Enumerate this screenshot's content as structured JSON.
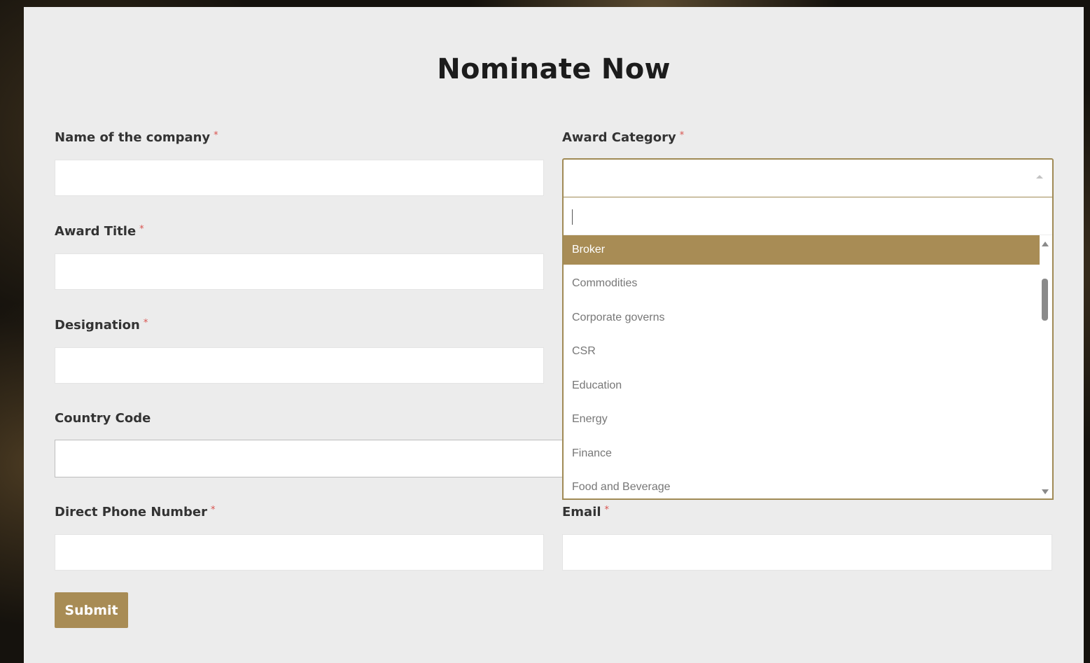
{
  "form": {
    "title": "Nominate Now",
    "required_mark": "*",
    "fields": {
      "company": {
        "label": "Name of the company",
        "value": ""
      },
      "award_category": {
        "label": "Award Category",
        "value": ""
      },
      "award_title": {
        "label": "Award Title",
        "value": ""
      },
      "designation": {
        "label": "Designation",
        "value": ""
      },
      "country_code": {
        "label": "Country Code",
        "value": ""
      },
      "phone": {
        "label": "Direct Phone Number",
        "value": ""
      },
      "email": {
        "label": "Email",
        "value": ""
      }
    },
    "dropdown": {
      "search_value": "",
      "options": [
        "Broker",
        "Commodities",
        "Corporate governs",
        "CSR",
        "Education",
        "Energy",
        "Finance",
        "Food and Beverage"
      ],
      "highlighted": "Broker"
    },
    "submit_label": "Submit"
  },
  "colors": {
    "accent": "#a88c55",
    "panel": "#ececec",
    "required": "#d9534f"
  },
  "icons": {
    "select_arrow": "caret-up-icon",
    "scroll_up": "scroll-up-arrow-icon",
    "scroll_down": "scroll-down-arrow-icon"
  }
}
